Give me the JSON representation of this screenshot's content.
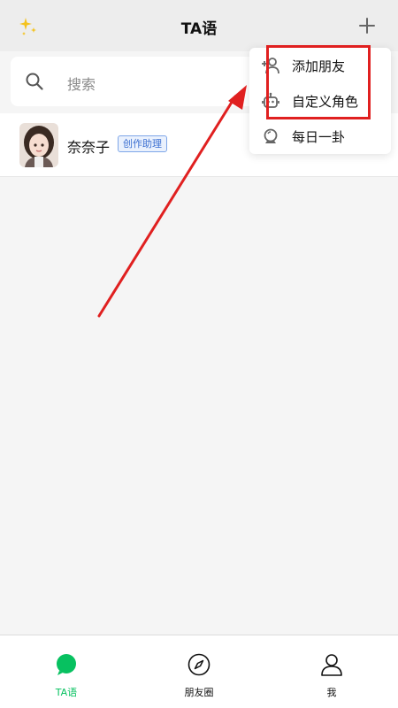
{
  "header": {
    "title": "TA语",
    "sparkle_icon": "sparkle-icon",
    "plus_icon": "plus-icon"
  },
  "search": {
    "placeholder": "搜索",
    "icon": "search-icon"
  },
  "chats": [
    {
      "name": "奈奈子",
      "badge": "创作助理",
      "avatar": "avatar"
    }
  ],
  "menu": {
    "items": [
      {
        "label": "添加朋友",
        "icon": "add-friend-icon"
      },
      {
        "label": "自定义角色",
        "icon": "robot-icon"
      },
      {
        "label": "每日一卦",
        "icon": "crystal-ball-icon"
      }
    ]
  },
  "bottom_nav": {
    "items": [
      {
        "label": "TA语",
        "icon": "chat-bubble-icon",
        "active": true
      },
      {
        "label": "朋友圈",
        "icon": "compass-icon",
        "active": false
      },
      {
        "label": "我",
        "icon": "person-icon",
        "active": false
      }
    ]
  },
  "colors": {
    "accent_green": "#07c160",
    "highlight_red": "#e02020",
    "badge_blue": "#3b6fd1"
  }
}
